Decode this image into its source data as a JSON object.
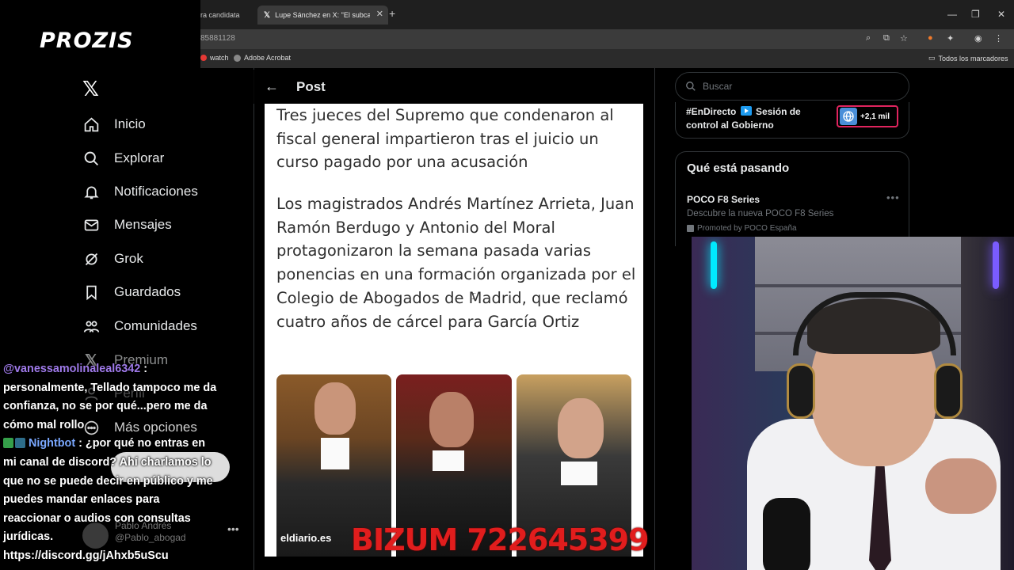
{
  "overlay": {
    "brand": "PROZIS",
    "bizum": "BIZUM 722645399"
  },
  "browser": {
    "tabs": [
      {
        "label": "ra candidata",
        "active": false
      },
      {
        "label": "Lupe Sánchez en X: \"El subcamp",
        "active": true
      }
    ],
    "url_fragment": "85881128",
    "bookmarks": [
      "watch",
      "Adobe Acrobat"
    ],
    "bookmarks_right": "Todos los marcadores"
  },
  "x_nav": {
    "items": [
      {
        "label": "Inicio",
        "icon": "home-icon"
      },
      {
        "label": "Explorar",
        "icon": "search-icon"
      },
      {
        "label": "Notificaciones",
        "icon": "bell-icon"
      },
      {
        "label": "Mensajes",
        "icon": "mail-icon"
      },
      {
        "label": "Grok",
        "icon": "grok-icon"
      },
      {
        "label": "Guardados",
        "icon": "bookmark-icon"
      },
      {
        "label": "Comunidades",
        "icon": "people-icon"
      },
      {
        "label": "Premium",
        "icon": "x-logo-icon"
      },
      {
        "label": "Perfil",
        "icon": "person-icon"
      },
      {
        "label": "Más opciones",
        "icon": "more-circle-icon"
      }
    ],
    "ghost_user": "Pablo Andrés",
    "ghost_handle": "@Pablo_abogad"
  },
  "post": {
    "header_title": "Post",
    "article_p1": "Tres jueces del Supremo que condenaron al fiscal general impartieron tras el juicio un curso pagado por una acusación",
    "article_p2": "Los magistrados Andrés Martínez Arrieta, Juan Ramón Berdugo y Antonio del Moral protagonizaron la semana pasada varias ponencias en una formación organizada por el Colegio de Abogados de Madrid, que reclamó cuatro años de cárcel para García Ortiz",
    "photo_source": "eldiario.es"
  },
  "right_col": {
    "search_placeholder": "Buscar",
    "live_text_a": "#EnDirecto",
    "live_text_b": "Sesión de control al Gobierno",
    "live_count": "+2,1 mil",
    "trends_title": "Qué está pasando",
    "trend_name": "POCO F8 Series",
    "trend_desc": "Descubre la nueva POCO F8 Series",
    "trend_promo": "Promoted by POCO España"
  },
  "chat": {
    "msg1_user": "@vanessamolinaleal6342",
    "msg1_text_1": " :",
    "msg1_text_2": "personalmente, Tellado tampoco me da",
    "msg1_text_3": "confianza, no se por qué...pero me da",
    "msg1_text_4": "cómo mal rollo",
    "msg2_user": "Nightbot",
    "msg2_text_1": ": ¿por qué no entras en",
    "msg2_text_2": "mi canal de discord? Ahí charlamos lo",
    "msg2_text_3": "que no se puede decir en público y me",
    "msg2_text_4": "puedes mandar enlaces para",
    "msg2_text_5": "reaccionar o audios con consultas",
    "msg2_text_6": "jurídicas.",
    "msg2_text_7": "https://discord.gg/jAhxb5uScu"
  },
  "colors": {
    "accent": "#1d9bf0",
    "bizum": "#e11d1d",
    "live_border": "#e0245e"
  }
}
